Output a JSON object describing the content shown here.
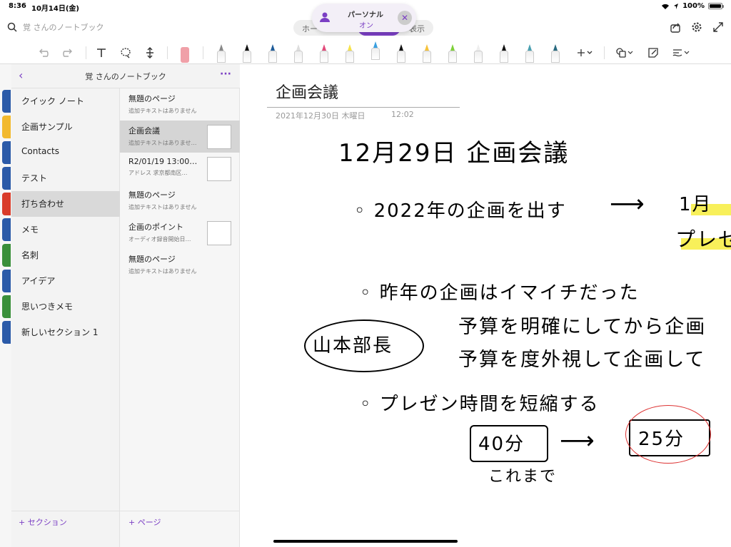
{
  "status": {
    "time": "8:36",
    "date": "10月14日(金)",
    "battery": "100%",
    "battery_level": 1.0
  },
  "search": {
    "placeholder": "覚 さんのノートブック"
  },
  "tabs": {
    "left": "ホー",
    "right": "表示"
  },
  "popup": {
    "name": "パーソナル",
    "state": "オン",
    "close": "✕"
  },
  "notebook": {
    "title": "覚 さんのノートブック",
    "back": "‹",
    "more": "···"
  },
  "sections": [
    {
      "label": "クイック ノート",
      "color": "#2b5aa8"
    },
    {
      "label": "企画サンプル",
      "color": "#f2b92e"
    },
    {
      "label": "Contacts",
      "color": "#2b5aa8"
    },
    {
      "label": "テスト",
      "color": "#2b5aa8"
    },
    {
      "label": "打ち合わせ",
      "color": "#d93c2a"
    },
    {
      "label": "メモ",
      "color": "#2b5aa8"
    },
    {
      "label": "名刺",
      "color": "#3a8f3a"
    },
    {
      "label": "アイデア",
      "color": "#2b5aa8"
    },
    {
      "label": "思いつきメモ",
      "color": "#3a8f3a"
    },
    {
      "label": "新しいセクション 1",
      "color": "#2b5aa8"
    }
  ],
  "pages": [
    {
      "title": "無題のページ",
      "sub": "追加テキストはありません"
    },
    {
      "title": "企画会議",
      "sub": "追加テキストはありませ…"
    },
    {
      "title": "R2/01/19 13:00…",
      "sub": "アドレス 求京都南区…"
    },
    {
      "title": "無題のページ",
      "sub": "追加テキストはありません"
    },
    {
      "title": "企画のポイント",
      "sub": "オーディオ録音開始日…"
    },
    {
      "title": "無題のページ",
      "sub": "追加テキストはありません"
    }
  ],
  "add_section": "+ セクション",
  "add_page": "+ ページ",
  "page": {
    "title": "企画会議",
    "date": "2021年12月30日 木曜日",
    "time": "12:02"
  },
  "ink": {
    "heading": "12月29日 企画会議",
    "l1": "◦ 2022年の企画を出す",
    "arrow1": "⟶",
    "l1r": "1月",
    "l1r2": "プレゼ",
    "l2": "◦ 昨年の企画はイマイチだった",
    "l3": "予算を明確にしてから企画",
    "l4": "予算を度外視して企画して",
    "circled": "山本部長",
    "l5": "◦ プレゼン時間を短縮する",
    "box1": "40分",
    "arrow2": "⟶",
    "box2": "25分",
    "note": "これまで"
  },
  "colors": {
    "accent": "#7b3fc4",
    "highlight": "#f8f05a",
    "red_ink": "#d33"
  }
}
